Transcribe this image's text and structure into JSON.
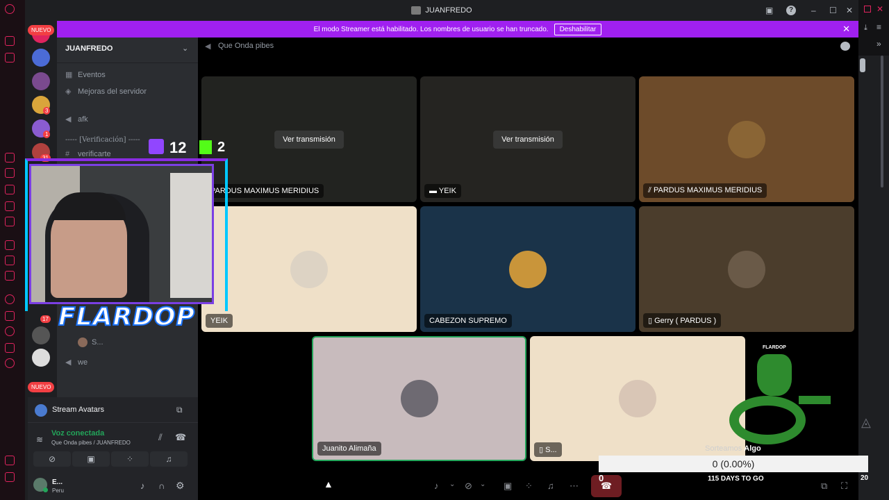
{
  "window": {
    "title": "JUANFREDO"
  },
  "banner": {
    "text": "El modo Streamer está habilitado. Los nombres de usuario se han truncado.",
    "disable_label": "Deshabilitar"
  },
  "servers": {
    "new_badge_top": "NUEVO",
    "new_badge_bottom": "NUEVO",
    "badges": [
      "3",
      "1",
      "31",
      "17"
    ]
  },
  "sidebar": {
    "server_name": "JUANFREDO",
    "items": [
      {
        "label": "Eventos",
        "icon": "calendar-icon"
      },
      {
        "label": "Mejoras del servidor",
        "icon": "boost-icon"
      },
      {
        "label": "afk",
        "icon": "speaker-icon"
      },
      {
        "label": "----- [Verificación] -----",
        "icon": "none"
      },
      {
        "label": "verificarte",
        "icon": "hashtag-icon"
      },
      {
        "label": "S...",
        "icon": "avatar"
      },
      {
        "label": "we",
        "icon": "speaker-icon"
      }
    ]
  },
  "voice": {
    "activity_name": "Stream Avatars",
    "status": "Voz conectada",
    "location": "Que Onda pibes / JUANFREDO",
    "user_name": "E...",
    "user_sub": "Peru",
    "status_color": "#23a55a"
  },
  "main": {
    "channel_name": "Que Onda pibes",
    "tiles": [
      {
        "name": "PARDUS MAXIMUS MERIDIUS",
        "watch": "Ver transmisión"
      },
      {
        "name": "YEIK",
        "watch": "Ver transmisión"
      },
      {
        "name": "PARDUS MAXIMUS MERIDIUS"
      },
      {
        "name": "YEIK"
      },
      {
        "name": "CABEZON SUPREMO"
      },
      {
        "name": "Gerry ( PARDUS )"
      },
      {
        "name": "Juanito Alimaña"
      },
      {
        "name": "S..."
      }
    ]
  },
  "overlay": {
    "twitch_count": "12",
    "kick_count": "2",
    "streamer_name": "FLARDOP",
    "pet_label": "FLARDOP",
    "giveaway_title_a": "Sorteamos",
    "giveaway_title_b": "Algo",
    "goal_progress": "0 (0.00%)",
    "goal_start": "0",
    "goal_end": "20",
    "days_left": "115 DAYS TO GO"
  }
}
